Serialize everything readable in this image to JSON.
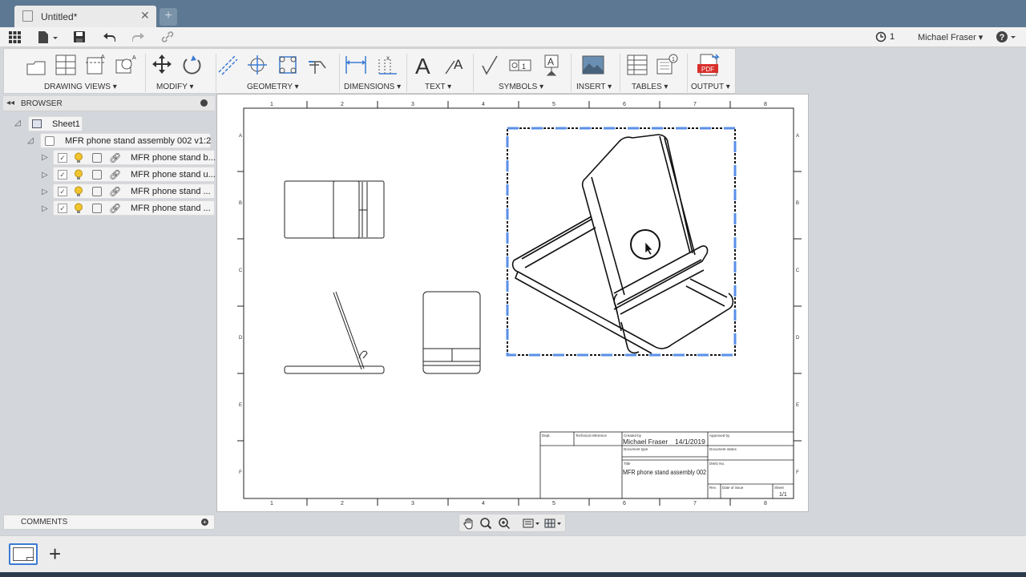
{
  "tab": {
    "title": "Untitled*"
  },
  "quick": {
    "jobs": "1",
    "user": "Michael Fraser"
  },
  "ribbon": {
    "groups": [
      {
        "label": "DRAWING VIEWS ▾"
      },
      {
        "label": "MODIFY ▾"
      },
      {
        "label": "GEOMETRY ▾"
      },
      {
        "label": "DIMENSIONS ▾"
      },
      {
        "label": "TEXT ▾"
      },
      {
        "label": "SYMBOLS ▾"
      },
      {
        "label": "INSERT ▾"
      },
      {
        "label": "TABLES ▾"
      },
      {
        "label": "OUTPUT ▾"
      }
    ],
    "pdf_badge": "PDF"
  },
  "browser": {
    "title": "BROWSER",
    "sheet": "Sheet1",
    "assembly": "MFR phone stand assembly 002 v1:2",
    "components": [
      {
        "label": "MFR phone stand b..."
      },
      {
        "label": "MFR phone stand u..."
      },
      {
        "label": "MFR phone stand ..."
      },
      {
        "label": "MFR phone stand ..."
      }
    ]
  },
  "comments": {
    "title": "COMMENTS"
  },
  "sheet": {
    "columns": [
      "1",
      "2",
      "3",
      "4",
      "5",
      "6",
      "7",
      "8"
    ],
    "rows": [
      "A",
      "B",
      "C",
      "D",
      "E",
      "F"
    ],
    "titleblock": {
      "dept": "Dept.",
      "tech_ref": "Technical reference",
      "created_by_label": "Created by",
      "created_by": "Michael Fraser",
      "date": "14/1/2019",
      "approved_by": "Approved by",
      "doc_type": "Document type",
      "doc_status": "Document status",
      "title_label": "Title",
      "title": "MFR phone stand assembly 002",
      "dwg_no": "DWG No.",
      "rev": "Rev.",
      "date_of_issue": "Date of issue",
      "sheet_label": "Sheet",
      "sheet": "1/1"
    }
  },
  "colors": {
    "tabbar": "#5d7892",
    "selection": "#5a8fe8",
    "pdf_red": "#d9302c"
  }
}
